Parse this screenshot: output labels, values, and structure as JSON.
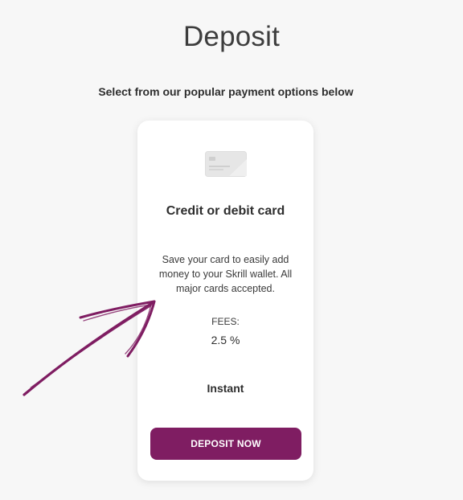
{
  "page": {
    "title": "Deposit",
    "subtitle": "Select from our popular payment options below"
  },
  "payment_option": {
    "icon": "credit-card-icon",
    "title": "Credit or debit card",
    "description": "Save your card to easily add money to your Skrill wallet. All major cards accepted.",
    "fees_label": "FEES:",
    "fees_value": "2.5 %",
    "speed": "Instant",
    "button_label": "DEPOSIT NOW"
  },
  "annotation": {
    "icon": "hand-drawn-arrow-icon",
    "color": "#7f1d62"
  },
  "colors": {
    "accent": "#7f1d62",
    "background": "#f7f7f7",
    "card": "#ffffff"
  }
}
